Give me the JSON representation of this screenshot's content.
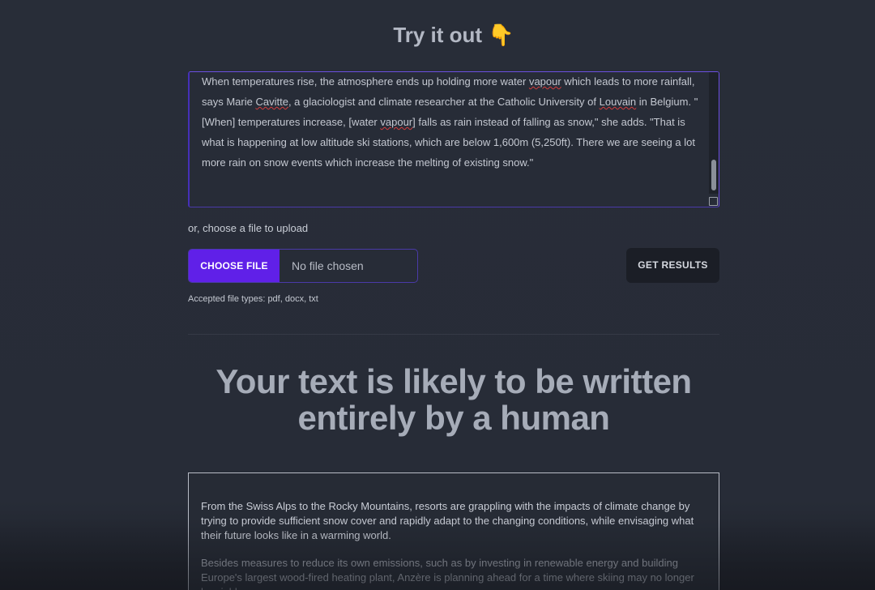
{
  "header": {
    "title": "Try it out 👇"
  },
  "editor": {
    "segments": [
      {
        "t": "When temperatures rise, the atmosphere ends up holding more water "
      },
      {
        "t": "vapour",
        "s": true
      },
      {
        "t": " which leads to more rainfall, says Marie "
      },
      {
        "t": "Cavitte",
        "s": true
      },
      {
        "t": ", a glaciologist and climate researcher at the Catholic University of "
      },
      {
        "t": "Louvain",
        "s": true
      },
      {
        "t": " in Belgium. \" [When] temperatures increase, [water "
      },
      {
        "t": "vapour",
        "s": true
      },
      {
        "t": "] falls as rain instead of falling as snow,\" she adds. \"That is what is happening at low altitude ski stations, which are below 1,600m (5,250ft). There we are seeing a lot more rain on snow events which increase the melting of existing snow.\""
      }
    ]
  },
  "upload": {
    "label": "or, choose a file to upload",
    "choose_button": "CHOOSE FILE",
    "status": "No file chosen",
    "accepted": "Accepted file types: pdf, docx, txt"
  },
  "actions": {
    "get_results": "GET RESULTS"
  },
  "result": {
    "headline": "Your text is likely to be written entirely by a human",
    "paragraphs": [
      "From the Swiss Alps to the Rocky Mountains, resorts are grappling with the impacts of climate change by trying to provide sufficient snow cover and rapidly adapt to the changing conditions, while envisaging what their future looks like in a warming world.",
      "Besides measures to reduce its own emissions, such as by investing in renewable energy and building Europe's largest wood-fired heating plant, Anzère is planning ahead for a time where skiing may no longer be viable."
    ]
  },
  "colors": {
    "accent": "#6020e8",
    "background": "#272c37",
    "button_dark": "#1b1e26"
  }
}
